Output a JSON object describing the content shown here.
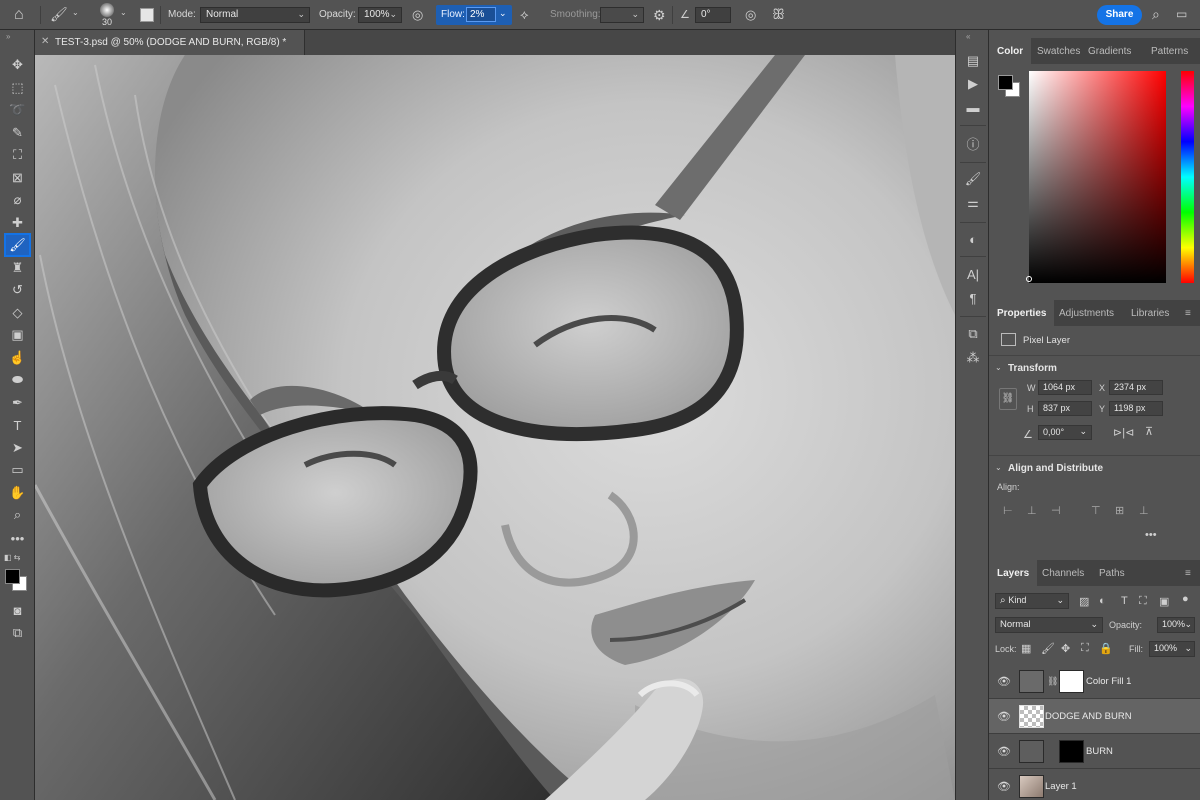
{
  "options_bar": {
    "brush_size": "30",
    "mode_label": "Mode:",
    "mode_value": "Normal",
    "opacity_label": "Opacity:",
    "opacity_value": "100%",
    "flow_label": "Flow:",
    "flow_value": "2%",
    "smoothing_label": "Smoothing:",
    "smoothing_value": "",
    "angle_value": "0°",
    "share_label": "Share"
  },
  "document": {
    "tab_title": "TEST-3.psd @ 50% (DODGE AND BURN, RGB/8) *"
  },
  "color_panel": {
    "tabs": [
      "Color",
      "Swatches",
      "Gradients",
      "Patterns"
    ],
    "foreground": "#000000",
    "background": "#ffffff"
  },
  "properties_panel": {
    "tabs": [
      "Properties",
      "Adjustments",
      "Libraries"
    ],
    "layer_kind": "Pixel Layer",
    "transform_title": "Transform",
    "w_label": "W",
    "w_value": "1064 px",
    "x_label": "X",
    "x_value": "2374 px",
    "h_label": "H",
    "h_value": "837 px",
    "y_label": "Y",
    "y_value": "1198 px",
    "angle_value": "0,00°",
    "align_title": "Align and Distribute",
    "align_label": "Align:"
  },
  "layers_panel": {
    "tabs": [
      "Layers",
      "Channels",
      "Paths"
    ],
    "filter_kind": "Kind",
    "blend_mode": "Normal",
    "opacity_label": "Opacity:",
    "opacity_value": "100%",
    "lock_label": "Lock:",
    "fill_label": "Fill:",
    "fill_value": "100%",
    "layers": [
      {
        "name": "Color Fill 1",
        "selected": false
      },
      {
        "name": "DODGE AND BURN",
        "selected": true
      },
      {
        "name": "BURN",
        "selected": false
      },
      {
        "name": "Layer 1",
        "selected": false
      }
    ]
  },
  "colors": {
    "accent": "#1473e6",
    "panel": "#535353",
    "panel_dark": "#424242"
  }
}
